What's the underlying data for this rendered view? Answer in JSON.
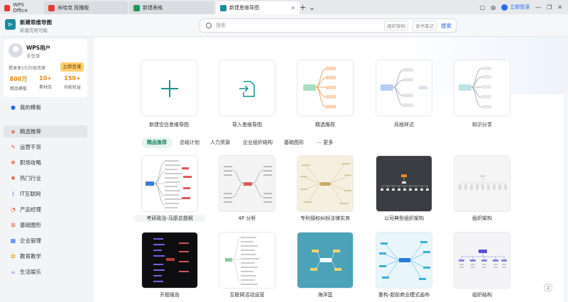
{
  "titlebar": {
    "tabs": [
      {
        "label": "WPS Office",
        "color": "#e53935"
      },
      {
        "label": "米哈克 投播版",
        "color": "#e53935"
      },
      {
        "label": "新建表格",
        "color": "#1a9a5b"
      },
      {
        "label": "新建思维导图",
        "color": "#1b8c9c"
      }
    ],
    "plus": "+ ⌄",
    "login": "立即登录"
  },
  "header": {
    "doc_title": "新建思维导图",
    "doc_sub": "新建完限可能",
    "search_placeholder": "搜索",
    "chip1": "组织架构",
    "chip2": "读书笔记",
    "search_button": "搜索"
  },
  "user": {
    "name": "WPS用户",
    "status": "未登录",
    "promo": "登录享1亿内容资源",
    "promo_button": "立即登录",
    "stats": [
      {
        "num": "800万",
        "label": "精品模板"
      },
      {
        "num": "10+",
        "label": "素材库"
      },
      {
        "num": "150+",
        "label": "功能权益"
      }
    ]
  },
  "nav": [
    {
      "label": "我的模板",
      "icon": "user-icon",
      "glyph": "👤"
    },
    {
      "label": "精选推荐",
      "icon": "recommend-icon",
      "glyph": "◈"
    },
    {
      "label": "运营干货",
      "icon": "megaphone-icon",
      "glyph": "✎"
    },
    {
      "label": "职场攻略",
      "icon": "briefcase-icon",
      "glyph": "❖"
    },
    {
      "label": "热门行业",
      "icon": "fire-icon",
      "glyph": "✹"
    },
    {
      "label": "IT互联网",
      "icon": "code-icon",
      "glyph": "⟨⟩"
    },
    {
      "label": "产品经理",
      "icon": "product-icon",
      "glyph": "◔"
    },
    {
      "label": "基础图形",
      "icon": "shapes-icon",
      "glyph": "⊞"
    },
    {
      "label": "企业管理",
      "icon": "building-icon",
      "glyph": "▦"
    },
    {
      "label": "教育教学",
      "icon": "education-icon",
      "glyph": "✿"
    },
    {
      "label": "生活娱乐",
      "icon": "cup-icon",
      "glyph": "☕"
    }
  ],
  "top_cards": [
    {
      "label": "新建空白思维导图"
    },
    {
      "label": "导入思维导图"
    },
    {
      "label": "精选推荐"
    },
    {
      "label": "风格样式"
    },
    {
      "label": "知识分享"
    }
  ],
  "filters": [
    "精品推荐",
    "总结计划",
    "人力资源",
    "企业组织结构",
    "基础图形",
    "⋯  更多"
  ],
  "templates": [
    {
      "label": "考研政治-马原总提纲",
      "bg": "#ffffff"
    },
    {
      "label": "4P 分析",
      "bg": "#f4f4f4"
    },
    {
      "label": "专利侵权纠纷法律实务",
      "bg": "#f6efe0"
    },
    {
      "label": "公司典型组织架构",
      "bg": "#3a3d42"
    },
    {
      "label": "组织架构",
      "bg": "#f5f5f5"
    },
    {
      "label": "开题报告",
      "bg": "#0e0e10"
    },
    {
      "label": "互联网活动运营",
      "bg": "#ffffff"
    },
    {
      "label": "海洋蓝",
      "bg": "#4aa3b8"
    },
    {
      "label": "重构-超前商业模式画布",
      "bg": "#e8f5fb"
    },
    {
      "label": "组织结构",
      "bg": "#f4f4f7"
    }
  ]
}
